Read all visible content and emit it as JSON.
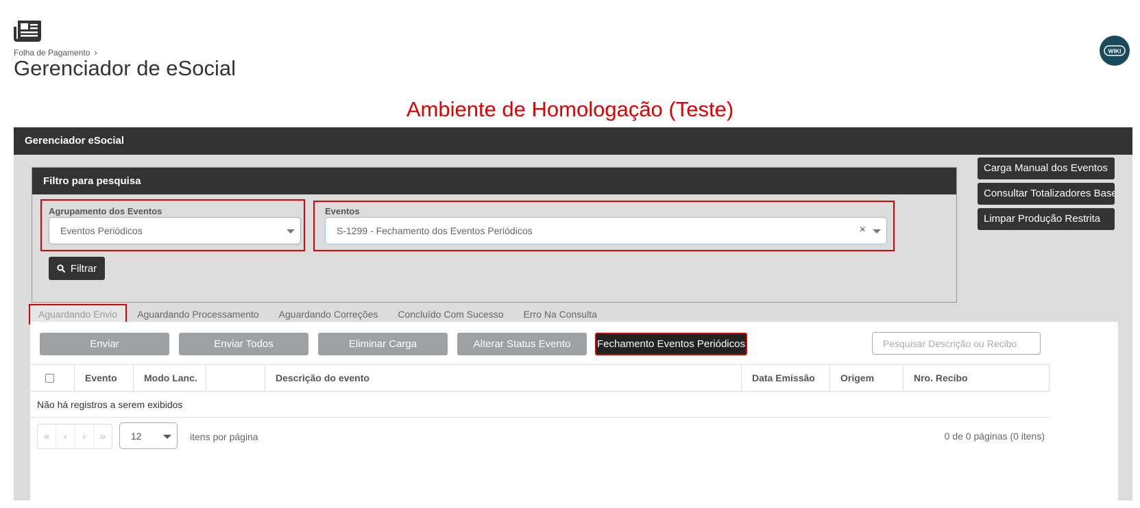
{
  "header": {
    "breadcrumb": "Folha de Pagamento",
    "title": "Gerenciador de eSocial",
    "wiki_label": "WIKI"
  },
  "environment_banner": "Ambiente de Homologação (Teste)",
  "panel": {
    "title": "Gerenciador eSocial",
    "filter": {
      "title": "Filtro para pesquisa",
      "group_label": "Agrupamento dos Eventos",
      "group_value": "Eventos Periódicos",
      "events_label": "Eventos",
      "events_value": "S-1299 - Fechamento dos Eventos Periódicos",
      "filter_button": "Filtrar"
    },
    "side_buttons": [
      "Carga Manual dos Eventos",
      "Consultar Totalizadores Base",
      "Limpar Produção Restrita"
    ]
  },
  "tabs": [
    "Aguardando Envio",
    "Aguardando Processamento",
    "Aguardando Correções",
    "Concluído Com Sucesso",
    "Erro Na Consulta"
  ],
  "actions": [
    "Enviar",
    "Enviar Todos",
    "Eliminar Carga",
    "Alterar Status Evento",
    "Fechamento Eventos Periódicos"
  ],
  "search": {
    "placeholder": "Pesquisar Descrição ou Recibo"
  },
  "grid": {
    "columns": [
      "Evento",
      "Modo Lanc.",
      "",
      "Descrição do evento",
      "Data Emissão",
      "Origem",
      "Nro. Recibo"
    ],
    "empty_message": "Não há registros a serem exibidos"
  },
  "pager": {
    "page_size": "12",
    "per_page_label": "itens por página",
    "info": "0 de 0 páginas (0 itens)"
  },
  "colors": {
    "highlight": "#e00000",
    "dark": "#333333",
    "panel_bg": "#dcdcdc",
    "button_gray": "#9ea1a4"
  }
}
